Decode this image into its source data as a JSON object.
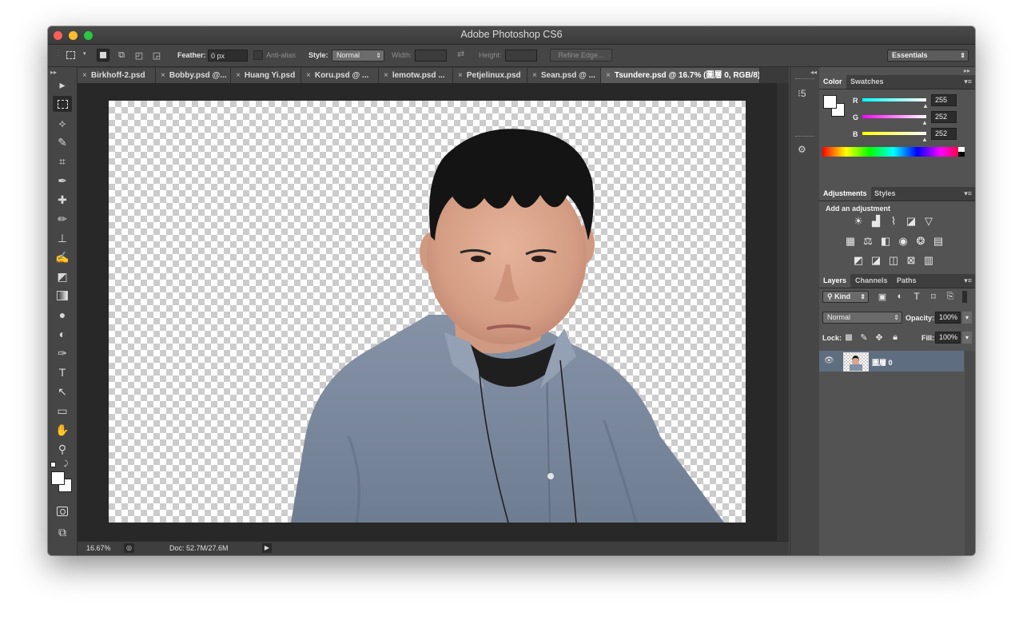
{
  "app": {
    "title": "Adobe Photoshop CS6"
  },
  "options": {
    "feather_label": "Feather:",
    "feather_value": "0 px",
    "antialias_label": "Anti-alias",
    "style_label": "Style:",
    "style_value": "Normal",
    "width_label": "Width:",
    "height_label": "Height:",
    "refine_edge": "Refine Edge...",
    "workspace": "Essentials"
  },
  "tabs": [
    {
      "label": "Birkhoff-2.psd"
    },
    {
      "label": "Bobby.psd @..."
    },
    {
      "label": "Huang Yi.psd"
    },
    {
      "label": "Koru.psd @ ..."
    },
    {
      "label": "lemotw.psd ..."
    },
    {
      "label": "Petjelinux.psd"
    },
    {
      "label": "Sean.psd @ ..."
    },
    {
      "label": "Tsundere.psd @ 16.7% (圖層 0, RGB/8)"
    }
  ],
  "status": {
    "zoom": "16.67%",
    "doc": "Doc: 52.7M/27.6M"
  },
  "color_panel": {
    "tabs": [
      "Color",
      "Swatches"
    ],
    "r_label": "R",
    "g_label": "G",
    "b_label": "B",
    "r": "255",
    "g": "252",
    "b": "252"
  },
  "adjustments_panel": {
    "tabs": [
      "Adjustments",
      "Styles"
    ],
    "heading": "Add an adjustment"
  },
  "layers_panel": {
    "tabs": [
      "Layers",
      "Channels",
      "Paths"
    ],
    "filter": "Kind",
    "blend_mode": "Normal",
    "opacity_label": "Opacity:",
    "opacity": "100%",
    "lock_label": "Lock:",
    "fill_label": "Fill:",
    "fill": "100%",
    "layers": [
      {
        "name": "圖層 0"
      }
    ]
  },
  "colors": {
    "accent_selection": "#5f6d80",
    "panel_bg": "#535353",
    "canvas_bg": "#282828"
  }
}
